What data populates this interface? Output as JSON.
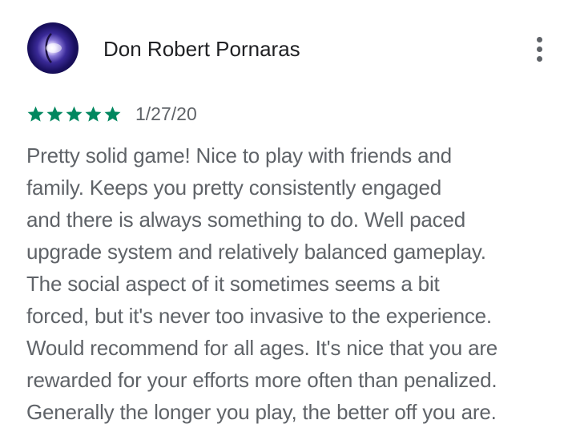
{
  "review": {
    "author": "Don Robert Pornaras",
    "rating": 5,
    "max_rating": 5,
    "date": "1/27/20",
    "lines": [
      "Pretty solid game! Nice to play with friends and",
      "family. Keeps you pretty consistently engaged",
      "and there is always something to do. Well paced",
      "upgrade system and relatively balanced gameplay.",
      "The social aspect of it sometimes seems a bit",
      "forced, but it's never too invasive to the experience.",
      "Would recommend for all ages. It's nice that you are",
      "rewarded for your efforts more often than penalized.",
      "Generally the longer you play, the better off you are."
    ]
  },
  "icons": {
    "avatar": "avatar",
    "star": "star-icon",
    "more": "more-vert-icon"
  },
  "colors": {
    "star": "#01875f",
    "name": "#202124",
    "secondary_text": "#5f6368"
  }
}
